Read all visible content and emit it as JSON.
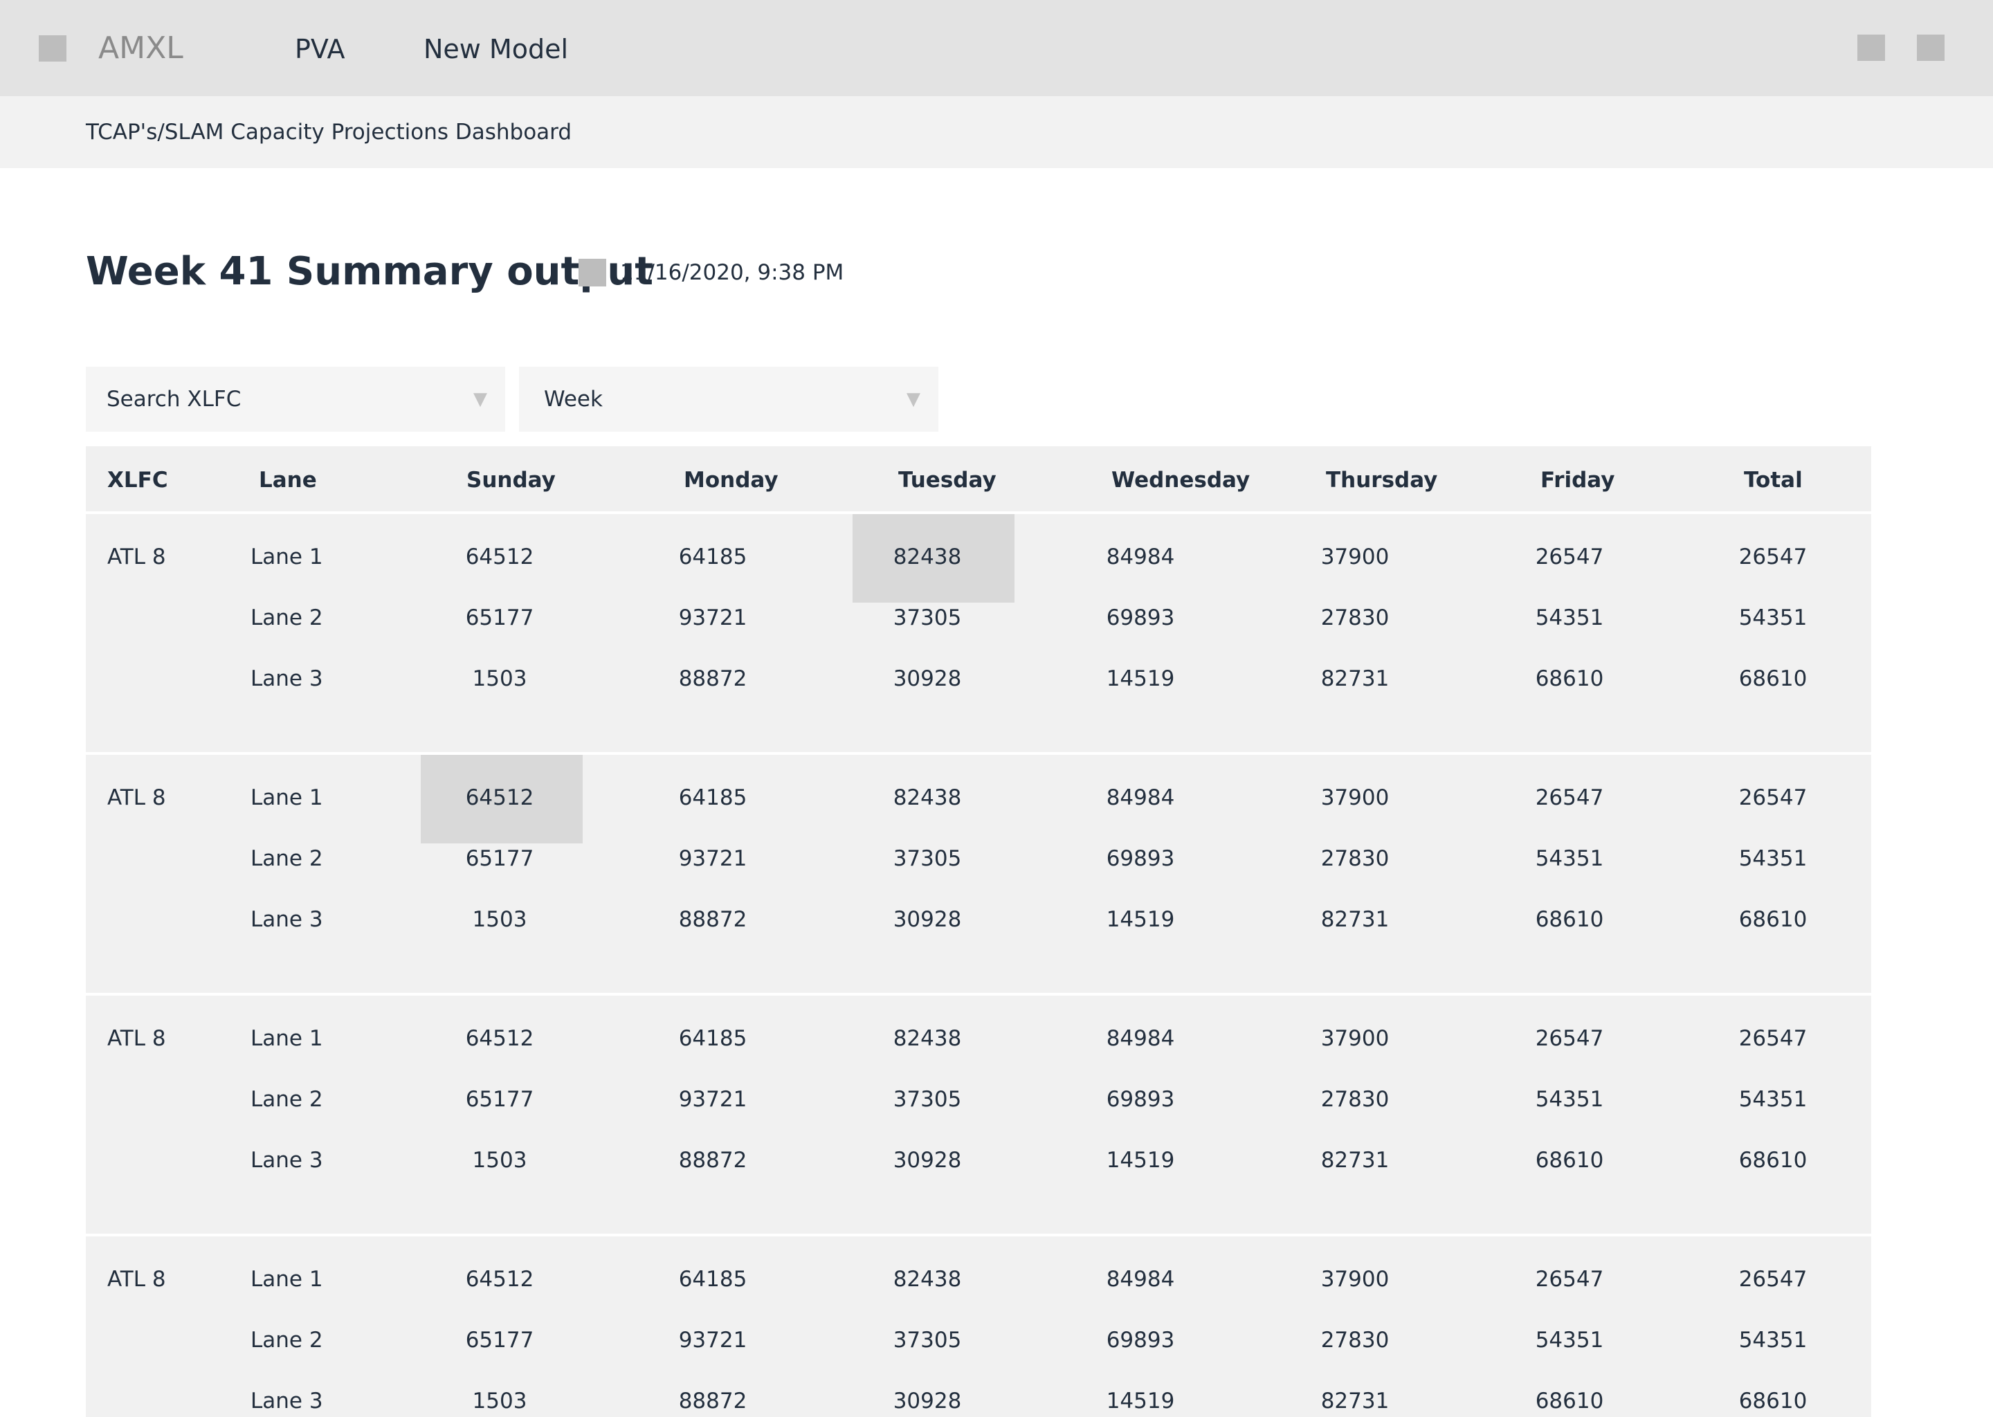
{
  "topbar": {
    "brand": "AMXL",
    "nav": [
      "PVA",
      "New Model"
    ]
  },
  "breadcrumb": "TCAP's/SLAM Capacity Projections Dashboard",
  "title": "Week 41 Summary output",
  "timestamp": "11/16/2020, 9:38 PM",
  "filters": {
    "xlfc_placeholder": "Search XLFC",
    "week_placeholder": "Week"
  },
  "table": {
    "columns": [
      "XLFC",
      "Lane",
      "Sunday",
      "Monday",
      "Tuesday",
      "Wednesday",
      "Thursday",
      "Friday",
      "Total"
    ],
    "groups": [
      {
        "xlfc": "ATL 8",
        "rows": [
          {
            "lane": "Lane 1",
            "values": [
              "64512",
              "64185",
              "82438",
              "84984",
              "37900",
              "26547",
              "26547"
            ]
          },
          {
            "lane": "Lane 2",
            "values": [
              "65177",
              "93721",
              "37305",
              "69893",
              "27830",
              "54351",
              "54351"
            ]
          },
          {
            "lane": "Lane 3",
            "values": [
              "1503",
              "88872",
              "30928",
              "14519",
              "82731",
              "68610",
              "68610"
            ]
          }
        ],
        "highlight": {
          "row": 0,
          "col": 2
        }
      },
      {
        "xlfc": "ATL 8",
        "rows": [
          {
            "lane": "Lane 1",
            "values": [
              "64512",
              "64185",
              "82438",
              "84984",
              "37900",
              "26547",
              "26547"
            ]
          },
          {
            "lane": "Lane 2",
            "values": [
              "65177",
              "93721",
              "37305",
              "69893",
              "27830",
              "54351",
              "54351"
            ]
          },
          {
            "lane": "Lane 3",
            "values": [
              "1503",
              "88872",
              "30928",
              "14519",
              "82731",
              "68610",
              "68610"
            ]
          }
        ],
        "highlight": {
          "row": 0,
          "col": 0
        }
      },
      {
        "xlfc": "ATL 8",
        "rows": [
          {
            "lane": "Lane 1",
            "values": [
              "64512",
              "64185",
              "82438",
              "84984",
              "37900",
              "26547",
              "26547"
            ]
          },
          {
            "lane": "Lane 2",
            "values": [
              "65177",
              "93721",
              "37305",
              "69893",
              "27830",
              "54351",
              "54351"
            ]
          },
          {
            "lane": "Lane 3",
            "values": [
              "1503",
              "88872",
              "30928",
              "14519",
              "82731",
              "68610",
              "68610"
            ]
          }
        ]
      },
      {
        "xlfc": "ATL 8",
        "rows": [
          {
            "lane": "Lane 1",
            "values": [
              "64512",
              "64185",
              "82438",
              "84984",
              "37900",
              "26547",
              "26547"
            ]
          },
          {
            "lane": "Lane 2",
            "values": [
              "65177",
              "93721",
              "37305",
              "69893",
              "27830",
              "54351",
              "54351"
            ]
          },
          {
            "lane": "Lane 3",
            "values": [
              "1503",
              "88872",
              "30928",
              "14519",
              "82731",
              "68610",
              "68610"
            ]
          }
        ]
      }
    ]
  }
}
